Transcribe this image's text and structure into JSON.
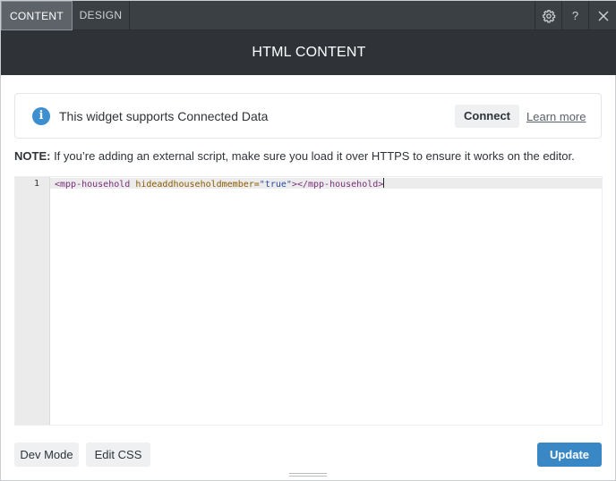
{
  "tabs": [
    {
      "label": "CONTENT",
      "active": true
    },
    {
      "label": "DESIGN",
      "active": false
    }
  ],
  "toolbar": {
    "settings_icon": "gear-icon",
    "help_label": "?",
    "close_icon": "close-icon"
  },
  "header": {
    "title": "HTML CONTENT"
  },
  "banner": {
    "icon": "info-icon",
    "icon_glyph": "i",
    "text": "This widget supports Connected Data",
    "connect_label": "Connect",
    "learn_more_label": "Learn more"
  },
  "note": {
    "label": "NOTE:",
    "text": " If you’re adding an external script, make sure you load it over HTTPS to ensure it works on the editor."
  },
  "editor": {
    "line_number": "1",
    "tokens": {
      "open_tag": "<mpp-household",
      "attr": " hideaddhouseholdmember=",
      "value": "\"true\"",
      "close_tag": "></mpp-household>"
    }
  },
  "footer": {
    "dev_mode_label": "Dev Mode",
    "edit_css_label": "Edit CSS",
    "update_label": "Update"
  },
  "colors": {
    "tabbar_bg": "#3b4045",
    "header_bg": "#2f3338",
    "accent_blue": "#3a87c6",
    "info_blue": "#3d8fd0"
  }
}
